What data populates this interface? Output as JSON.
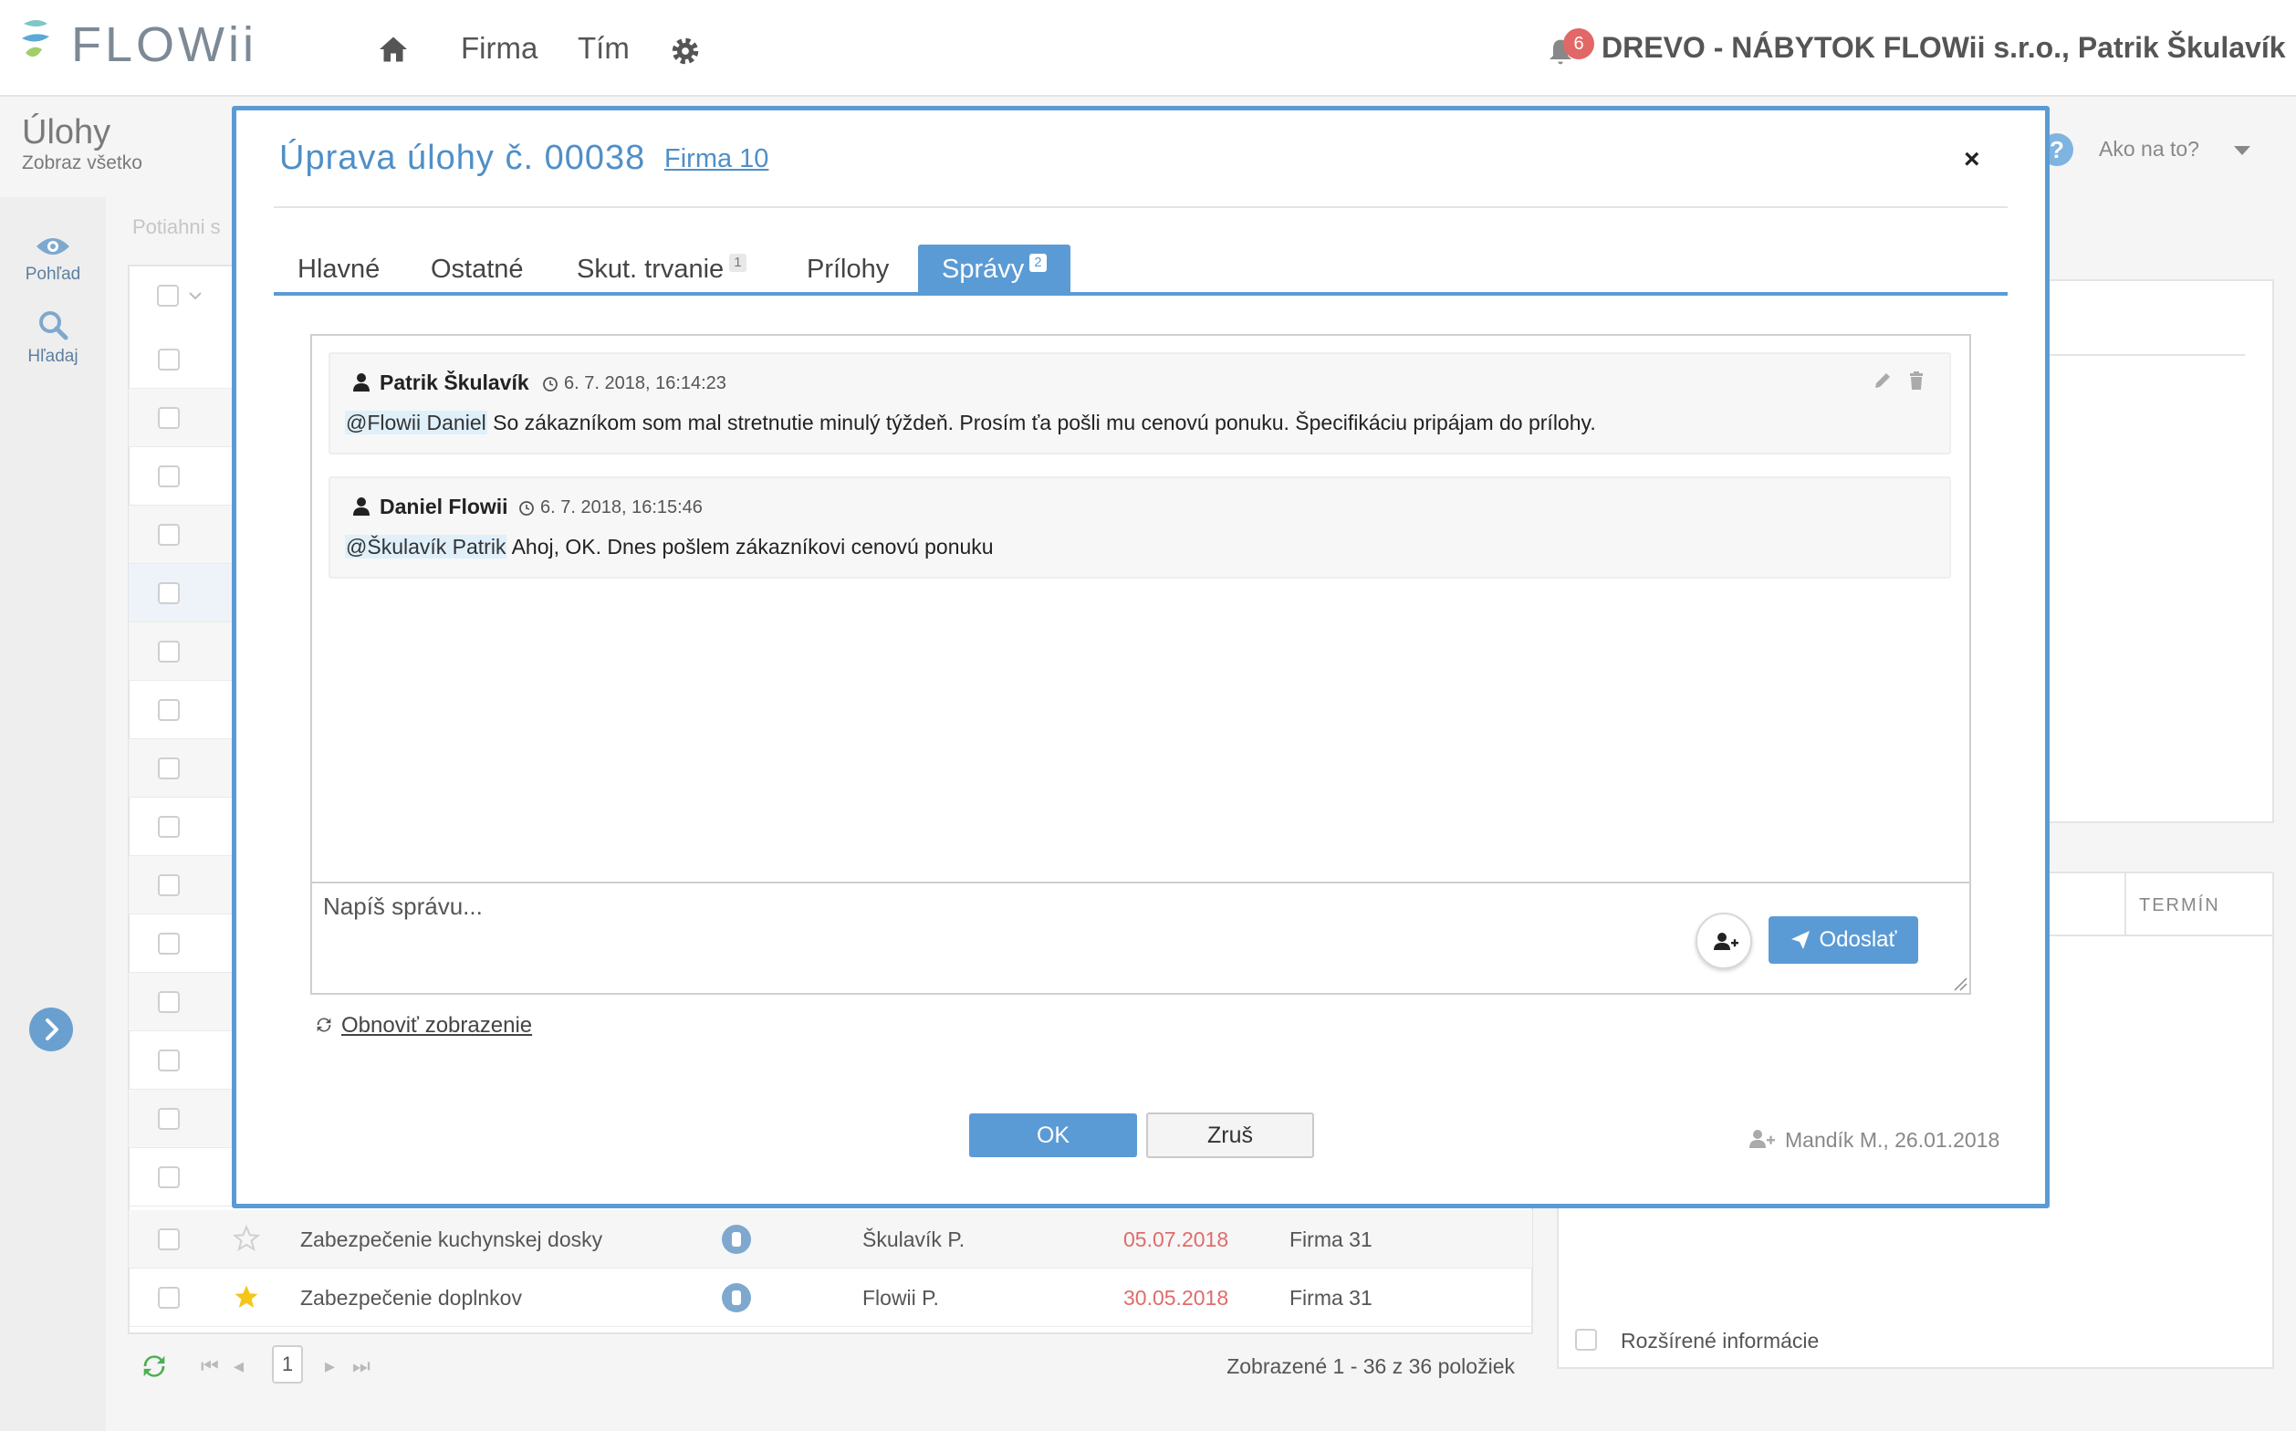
{
  "header": {
    "brand": "FLOWii",
    "nav": {
      "firma": "Firma",
      "tim": "Tím"
    },
    "notifications_count": "6",
    "company_user": "DREVO - NÁBYTOK FLOWii s.r.o., Patrik Škulavík"
  },
  "page": {
    "title": "Úlohy",
    "subtitle": "Zobraz všetko",
    "drag_hint": "Potiahni s"
  },
  "left_rail": {
    "view": "Pohľad",
    "search": "Hľadaj"
  },
  "right_panel": {
    "howto": "Ako na to?",
    "help": "?",
    "col_termin": "TERMÍN",
    "extended_info": "Rozšírené informácie"
  },
  "table": {
    "rows": [
      {
        "name": "Zabezpečenie kuchynskej dosky",
        "assignee": "Škulavík P.",
        "date": "05.07.2018",
        "firm": "Firma 31",
        "starred": false
      },
      {
        "name": "Zabezpečenie doplnkov",
        "assignee": "Flowii P.",
        "date": "30.05.2018",
        "firm": "Firma 31",
        "starred": true
      }
    ],
    "pager": {
      "current_page": "1",
      "info": "Zobrazené 1 - 36 z 36 položiek"
    }
  },
  "modal": {
    "title": "Úprava úlohy č. 00038",
    "firm_link": "Firma 10",
    "close": "×",
    "tabs": [
      {
        "label": "Hlavné",
        "count": ""
      },
      {
        "label": "Ostatné",
        "count": ""
      },
      {
        "label": "Skut. trvanie",
        "count": "1"
      },
      {
        "label": "Prílohy",
        "count": ""
      },
      {
        "label": "Správy",
        "count": "2"
      }
    ],
    "active_tab": "Správy",
    "messages": [
      {
        "author": "Patrik Škulavík",
        "time": "6. 7. 2018, 16:14:23",
        "mention": "@Flowii Daniel",
        "text": " So zákazníkom som mal stretnutie minulý týždeň. Prosím ťa pošli mu cenovú ponuku. Špecifikáciu pripájam do prílohy."
      },
      {
        "author": "Daniel Flowii",
        "time": "6. 7. 2018, 16:15:46",
        "mention": "@Škulavík Patrik",
        "text": " Ahoj, OK. Dnes pošlem zákazníkovi cenovú ponuku"
      }
    ],
    "compose_placeholder": "Napíš správu...",
    "send_label": "Odoslať",
    "refresh_label": "Obnoviť zobrazenie",
    "ok_label": "OK",
    "cancel_label": "Zruš",
    "created_by": "Mandík M., 26.01.2018"
  },
  "colors": {
    "accent": "#5b9bd5",
    "overdue": "#e06b6b",
    "star": "#f5c518",
    "badge": "#e26767"
  }
}
